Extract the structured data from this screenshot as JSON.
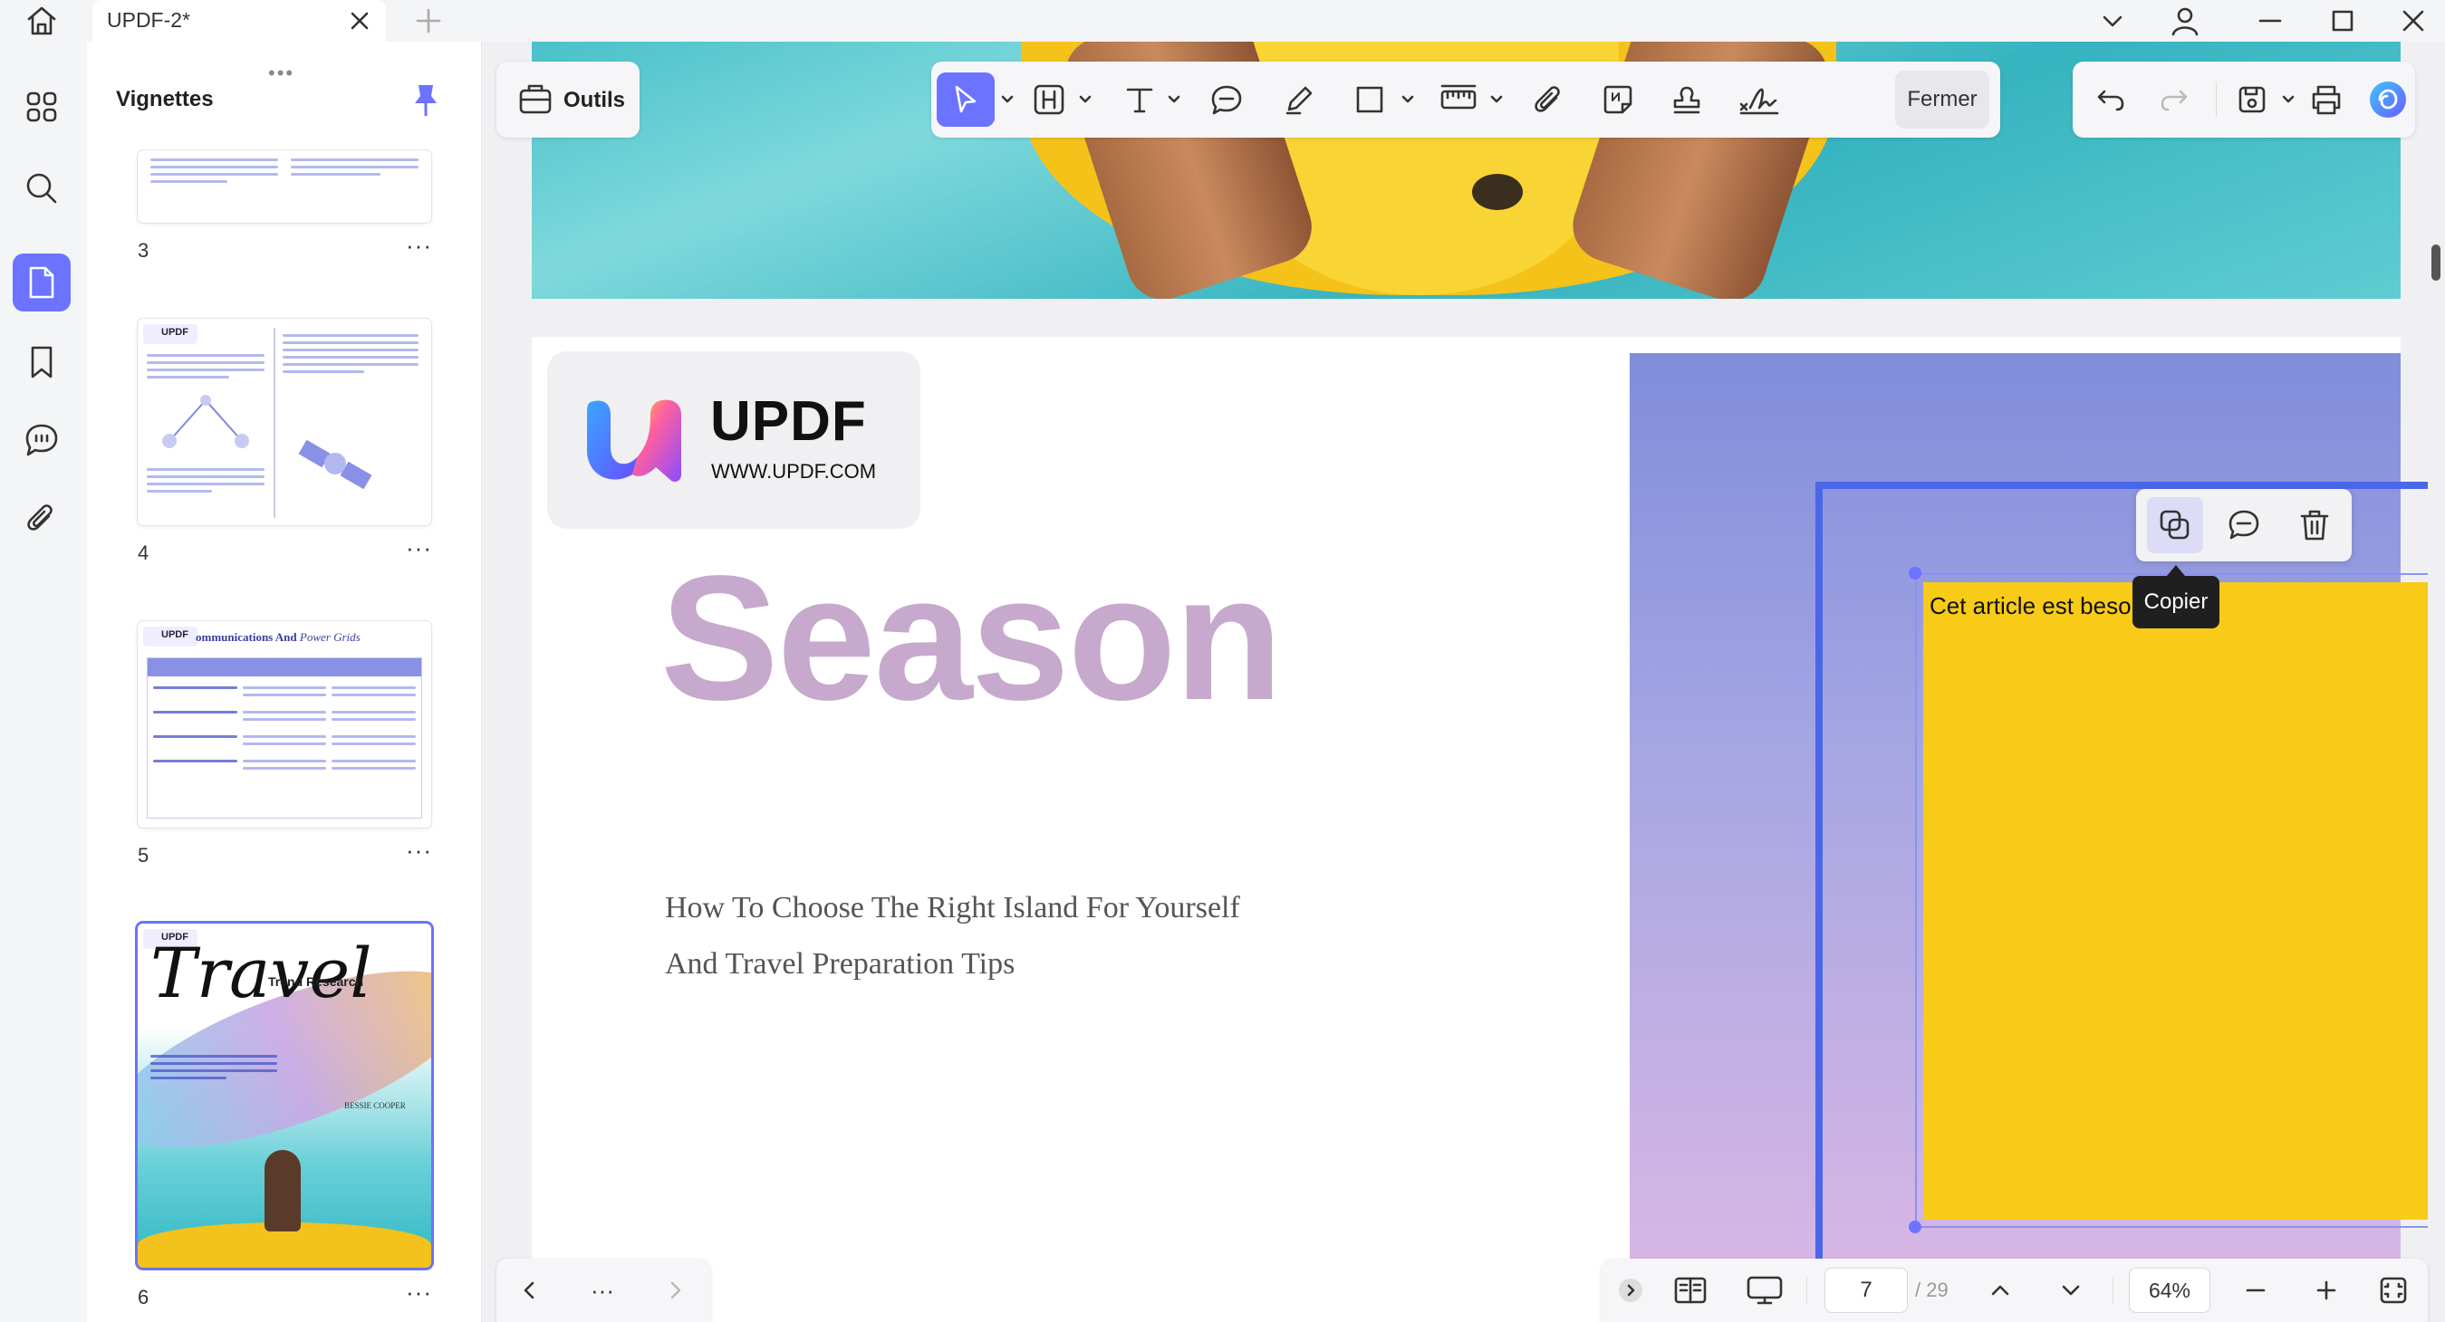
{
  "titlebar": {
    "tab_title": "UPDF-2*"
  },
  "sidebar": {
    "title": "Vignettes",
    "thumbnails": [
      {
        "page": "3"
      },
      {
        "page": "4"
      },
      {
        "page": "5",
        "header_title": "ommunications And ",
        "header_title_italic": "Power Grids"
      },
      {
        "page": "6",
        "title_script": "Travel",
        "subtitle": "Trend Research",
        "author": "BESSIE COOPER"
      }
    ]
  },
  "toolbar": {
    "outils_label": "Outils",
    "fermer_label": "Fermer"
  },
  "document": {
    "logo_text": "UPDF",
    "logo_url": "WWW.UPDF.COM",
    "thumb_logo": "UPDF",
    "big_title": "Season",
    "subtitle_line1": "How To Choose The Right Island For Yourself",
    "subtitle_line2": "And Travel Preparation Tips",
    "sticky_note_text": "Cet article est beso"
  },
  "annotation_toolbar": {
    "tooltip": "Copier"
  },
  "statusbar": {
    "current_page": "7",
    "total_pages": "/ 29",
    "zoom": "64%"
  },
  "colors": {
    "accent": "#6b73ff",
    "selection_border": "#4a67e8",
    "sticky_note": "#f7cb17",
    "title_lilac": "#c7a9cd"
  }
}
